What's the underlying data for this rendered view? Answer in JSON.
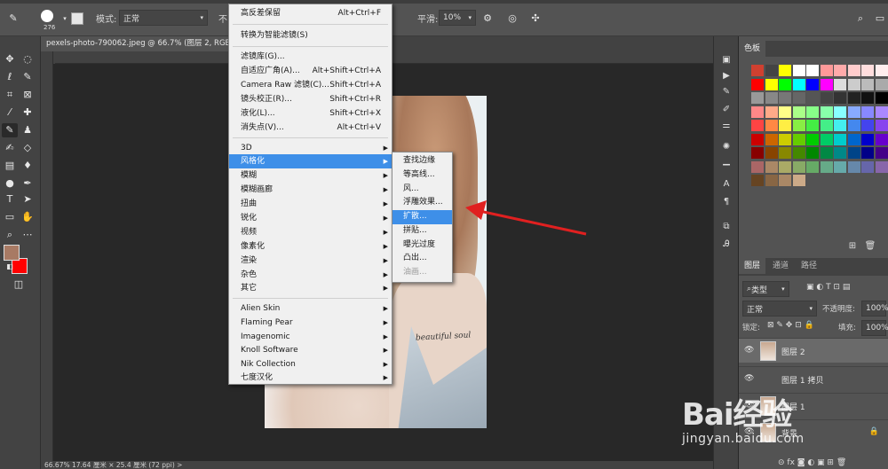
{
  "options_bar": {
    "brush_size": "276",
    "mode_label": "模式:",
    "mode_value": "正常",
    "opacity_prefix": "不",
    "smooth_label": "平滑:",
    "smooth_value": "10%"
  },
  "document_tab": {
    "title": "pexels-photo-790062.jpeg @ 66.7% (图层 2, RGB/8"
  },
  "filter_menu": {
    "items": [
      {
        "label": "高反差保留",
        "shortcut": "Alt+Ctrl+F"
      },
      {
        "label": "转换为智能滤镜(S)",
        "shortcut": ""
      },
      {
        "label": "滤镜库(G)...",
        "shortcut": ""
      },
      {
        "label": "自适应广角(A)...",
        "shortcut": "Alt+Shift+Ctrl+A"
      },
      {
        "label": "Camera Raw 滤镜(C)...",
        "shortcut": "Shift+Ctrl+A"
      },
      {
        "label": "镜头校正(R)...",
        "shortcut": "Shift+Ctrl+R"
      },
      {
        "label": "液化(L)...",
        "shortcut": "Shift+Ctrl+X"
      },
      {
        "label": "消失点(V)...",
        "shortcut": "Alt+Ctrl+V"
      },
      {
        "label": "3D"
      },
      {
        "label": "风格化"
      },
      {
        "label": "模糊"
      },
      {
        "label": "模糊画廊"
      },
      {
        "label": "扭曲"
      },
      {
        "label": "锐化"
      },
      {
        "label": "视频"
      },
      {
        "label": "像素化"
      },
      {
        "label": "渲染"
      },
      {
        "label": "杂色"
      },
      {
        "label": "其它"
      },
      {
        "label": "Alien Skin"
      },
      {
        "label": "Flaming Pear"
      },
      {
        "label": "Imagenomic"
      },
      {
        "label": "Knoll Software"
      },
      {
        "label": "Nik Collection"
      },
      {
        "label": "七度汉化"
      }
    ]
  },
  "stylize_submenu": {
    "items": [
      "查找边缘",
      "等高线...",
      "风...",
      "浮雕效果...",
      "扩散...",
      "拼贴...",
      "曝光过度",
      "凸出...",
      "油画..."
    ]
  },
  "swatches_panel": {
    "tab": "色板"
  },
  "layers_panel": {
    "tabs": [
      "图层",
      "通道",
      "路径"
    ],
    "filter_kind": "类型",
    "blend_mode": "正常",
    "opacity_label": "不透明度:",
    "opacity_value": "100%",
    "lock_label": "锁定:",
    "fill_label": "填充:",
    "fill_value": "100%",
    "layers": [
      {
        "name": "图层 2",
        "selected": true,
        "locked": false
      },
      {
        "name": "图层 1 拷贝",
        "selected": false,
        "locked": false
      },
      {
        "name": "图层 1",
        "selected": false,
        "locked": false
      },
      {
        "name": "背景",
        "selected": false,
        "locked": true
      }
    ]
  },
  "status_bar": {
    "text": "66.67%    17.64 厘米 × 25.4 厘米 (72 ppi)    >"
  },
  "canvas": {
    "tattoo_text": "beautiful soul"
  },
  "watermark": {
    "brand": "Bai经验",
    "url": "jingyan.baidu.com"
  },
  "colors": {
    "foreground": "#a87a64",
    "background": "#ff0000",
    "menu_highlight": "#3e8fe8",
    "annotation_arrow": "#e02020"
  }
}
